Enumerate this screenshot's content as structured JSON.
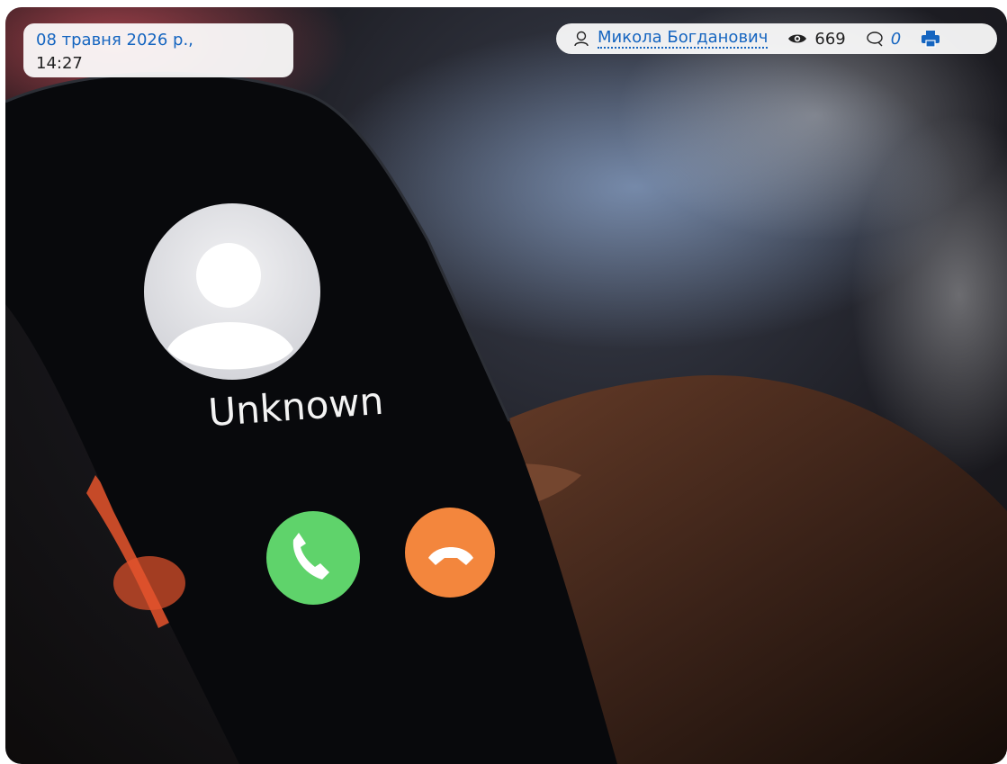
{
  "post": {
    "date": "08 травня 2026 р.,",
    "time": "14:27",
    "author": "Микола Богданович",
    "views": "669",
    "comments": "0"
  },
  "photo": {
    "caller_label": "Unknown"
  },
  "icons": {
    "author": "user-icon",
    "views": "eye-icon",
    "comments": "comment-icon",
    "print": "printer-icon"
  },
  "colors": {
    "link": "#1565c0",
    "accept_button": "#5fd36b",
    "decline_button": "#f3863d"
  }
}
